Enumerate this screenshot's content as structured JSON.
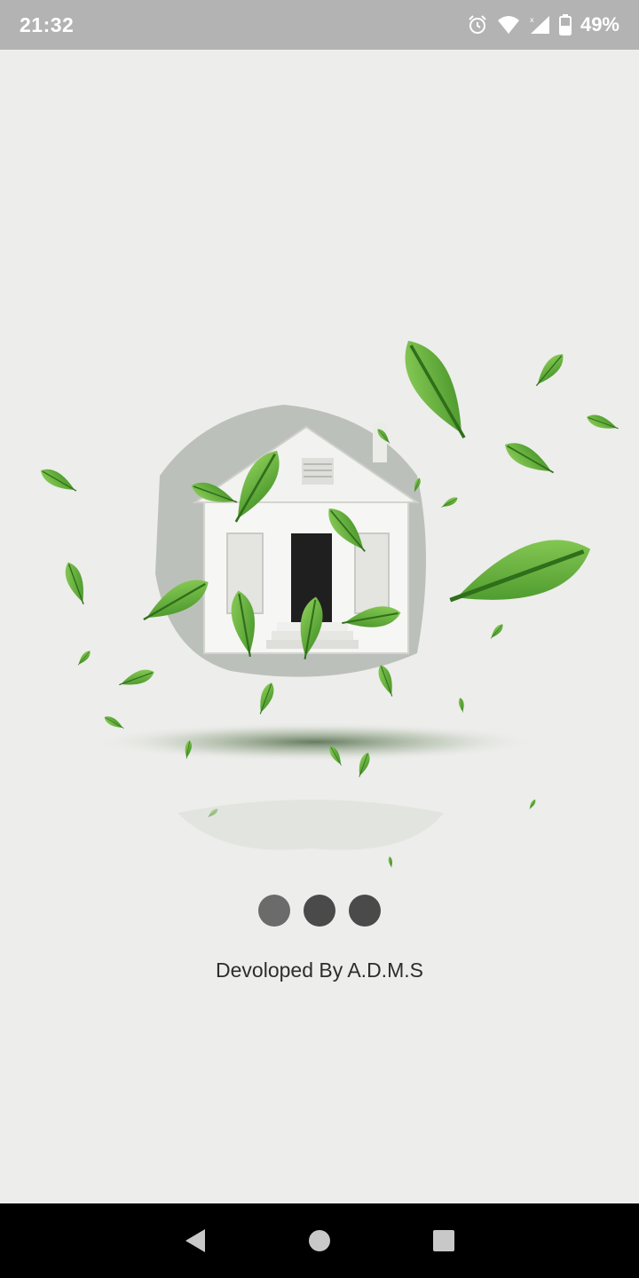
{
  "status_bar": {
    "time": "21:32",
    "battery_percent": "49%",
    "icons": [
      "alarm-icon",
      "wifi-icon",
      "signal-icon",
      "battery-icon"
    ]
  },
  "splash": {
    "illustration": "house-with-green-leaves",
    "loading_dots": 3,
    "developer_credit": "Devoloped By A.D.M.S"
  },
  "nav_bar": {
    "buttons": [
      "back-icon",
      "home-icon",
      "recents-icon"
    ]
  },
  "colors": {
    "background": "#ededeb",
    "status_bar": "#b3b3b3",
    "leaf_green": "#5aa832",
    "dot": "#4a4a4a"
  }
}
